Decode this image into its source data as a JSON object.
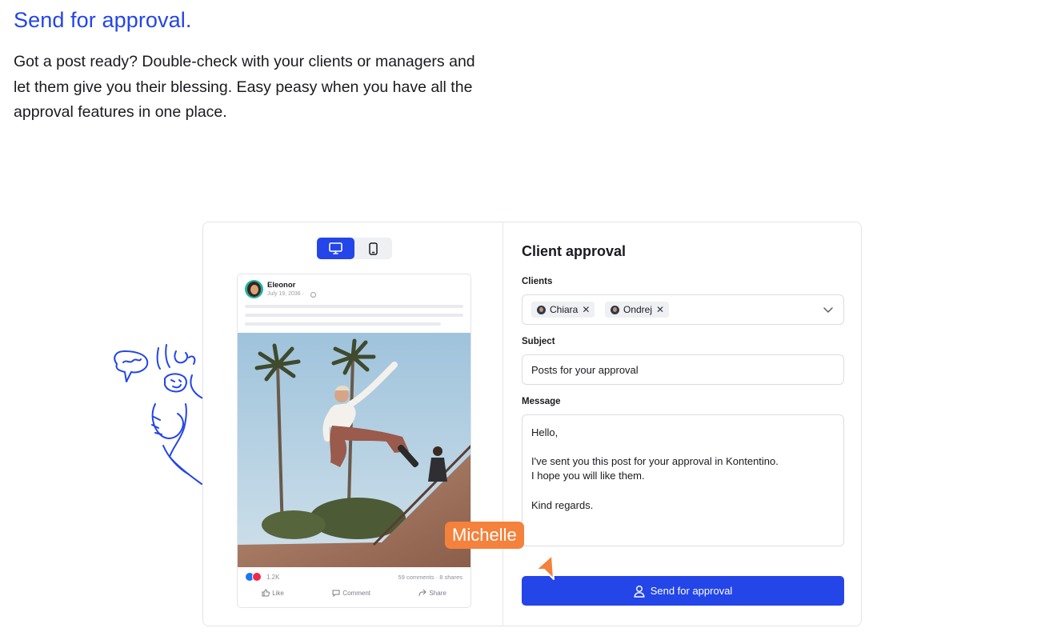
{
  "hero": {
    "title": "Send for approval.",
    "description": "Got a post ready? Double-check with your clients or managers and let them give you their blessing. Easy peasy when you have all the approval features in one place."
  },
  "preview": {
    "device_toggle": {
      "desktop_icon": "monitor-icon",
      "mobile_icon": "smartphone-icon",
      "selected": "desktop"
    },
    "post": {
      "author": "Eleonor",
      "date": "July 19, 2036 ·",
      "reaction_count": "1.2K",
      "stats": "59 comments · 8 shares",
      "actions": {
        "like": "Like",
        "comment": "Comment",
        "share": "Share"
      }
    }
  },
  "approval": {
    "title": "Client approval",
    "clients_label": "Clients",
    "clients": [
      {
        "name": "Chiara"
      },
      {
        "name": "Ondrej"
      }
    ],
    "subject_label": "Subject",
    "subject_value": "Posts for your approval",
    "message_label": "Message",
    "message_lines": [
      "Hello,",
      "",
      "I've sent you this post for your approval in Kontentino.",
      "I hope you will like them.",
      "",
      "Kind regards."
    ],
    "send_button": "Send for approval"
  },
  "cursor": {
    "name": "Michelle",
    "color": "#f4813c"
  },
  "colors": {
    "brand": "#2445e8",
    "accent": "#f4813c"
  }
}
